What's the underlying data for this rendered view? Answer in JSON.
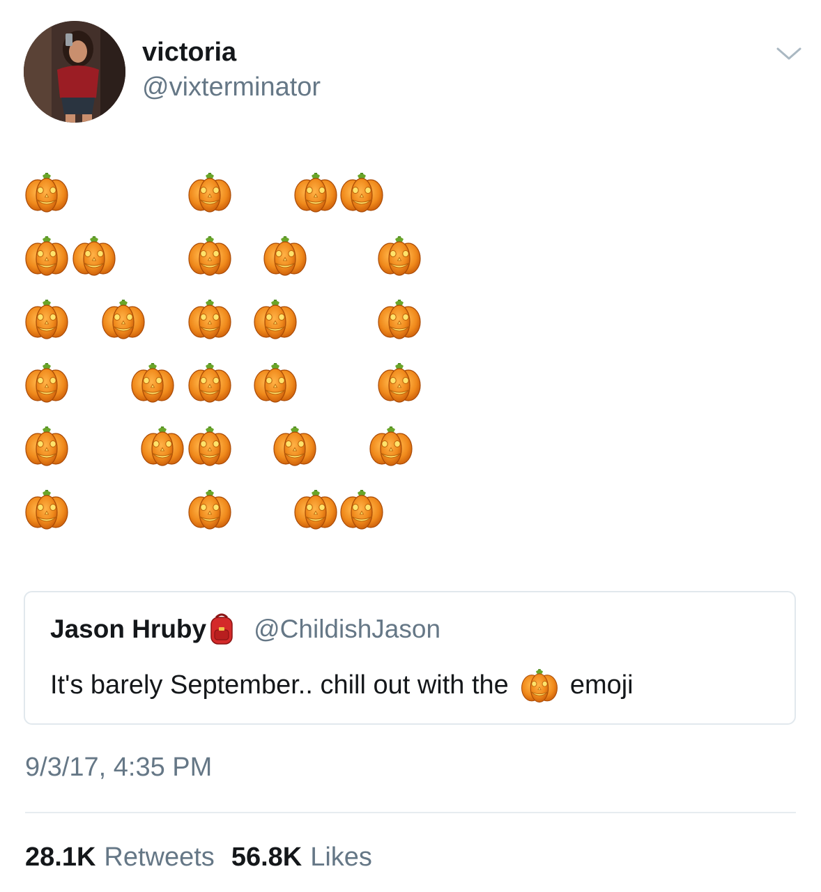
{
  "tweet": {
    "author": {
      "display_name": "victoria",
      "handle": "@vixterminator"
    },
    "body": {
      "emoji": "pumpkin-icon",
      "pumpkin_count": 29
    },
    "quoted_tweet": {
      "display_name": "Jason Hruby",
      "name_emoji": "backpack-icon",
      "handle": "@ChildishJason",
      "text_before": "It's barely September.. chill out with the",
      "inline_emoji": "pumpkin-icon",
      "text_after": "emoji"
    },
    "timestamp": "9/3/17, 4:35 PM",
    "stats": {
      "retweets_count": "28.1K",
      "retweets_label": "Retweets",
      "likes_count": "56.8K",
      "likes_label": "Likes"
    }
  },
  "colors": {
    "secondary_text": "#657786",
    "primary_text": "#14171a",
    "pumpkin_orange": "#f08a1c",
    "border": "#e1e8ed"
  }
}
